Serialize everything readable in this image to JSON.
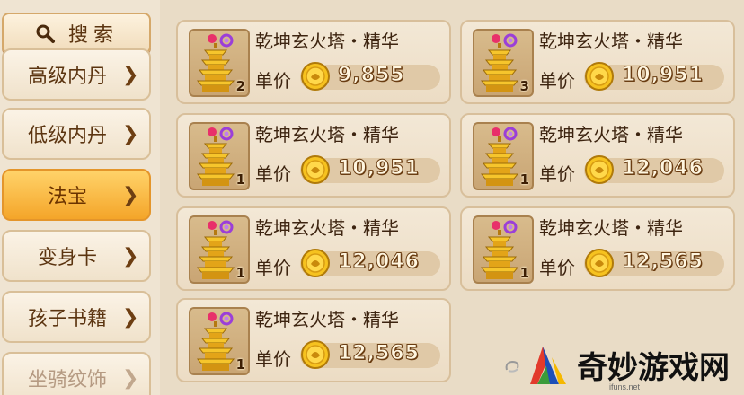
{
  "sidebar": {
    "search_label": "搜索",
    "items": [
      {
        "label": "高级内丹",
        "state": "normal"
      },
      {
        "label": "低级内丹",
        "state": "normal"
      },
      {
        "label": "法宝",
        "state": "active"
      },
      {
        "label": "变身卡",
        "state": "normal"
      },
      {
        "label": "孩子书籍",
        "state": "normal"
      },
      {
        "label": "坐骑纹饰",
        "state": "faded"
      }
    ]
  },
  "listings": [
    {
      "name": "乾坤玄火塔・精华",
      "qty": "2",
      "price_label": "单价",
      "price": "9,855"
    },
    {
      "name": "乾坤玄火塔・精华",
      "qty": "3",
      "price_label": "单价",
      "price": "10,951"
    },
    {
      "name": "乾坤玄火塔・精华",
      "qty": "1",
      "price_label": "单价",
      "price": "10,951"
    },
    {
      "name": "乾坤玄火塔・精华",
      "qty": "1",
      "price_label": "单价",
      "price": "12,046"
    },
    {
      "name": "乾坤玄火塔・精华",
      "qty": "1",
      "price_label": "单价",
      "price": "12,046"
    },
    {
      "name": "乾坤玄火塔・精华",
      "qty": "1",
      "price_label": "单价",
      "price": "12,565"
    },
    {
      "name": "乾坤玄火塔・精华",
      "qty": "1",
      "price_label": "单价",
      "price": "12,565"
    }
  ],
  "watermark": {
    "text": "奇妙游戏网",
    "sub": "ifuns.net"
  },
  "icons": {
    "search": "search-icon",
    "chevron": "chevron-right-icon",
    "item": "pagoda-icon",
    "coin": "coin-icon"
  },
  "colors": {
    "active": "#f4a529",
    "background": "#e9dcc6"
  }
}
